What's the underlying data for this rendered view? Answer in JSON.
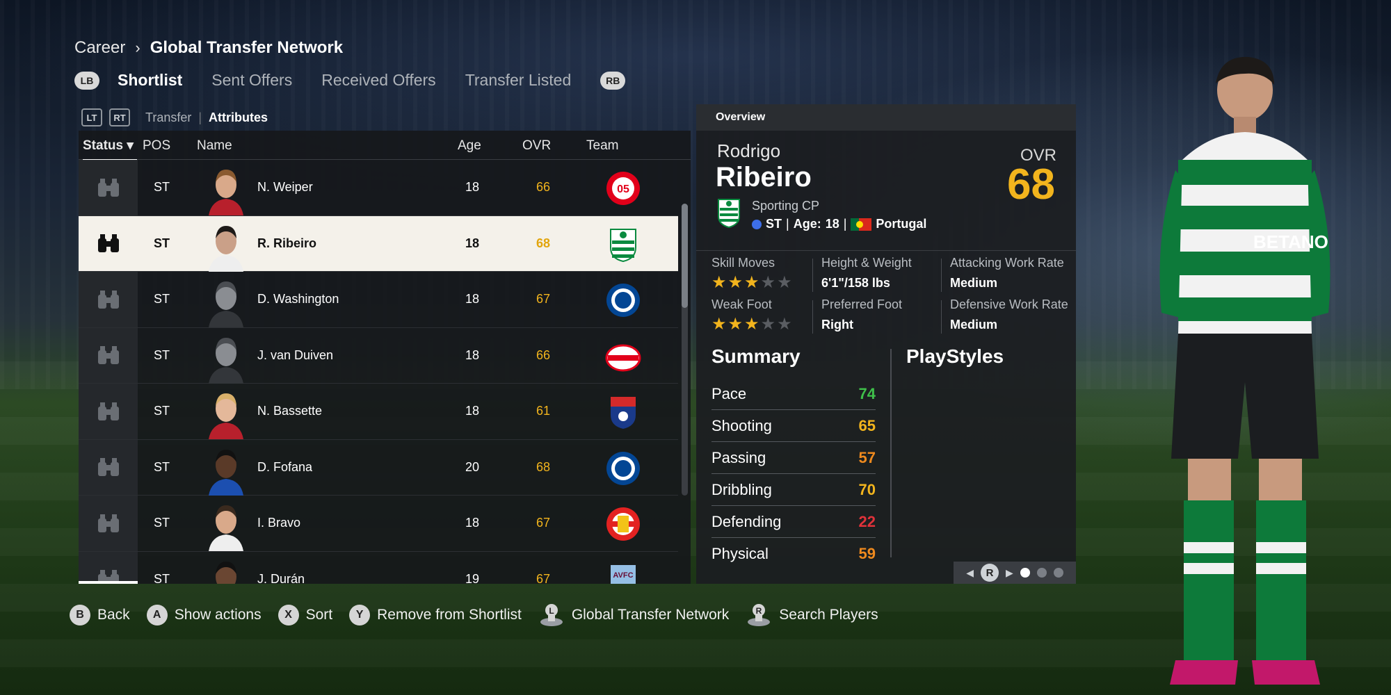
{
  "breadcrumb": {
    "root": "Career",
    "separator": "›",
    "current": "Global Transfer Network"
  },
  "tabs": {
    "left_button": "LB",
    "right_button": "RB",
    "items": [
      {
        "label": "Shortlist",
        "active": true
      },
      {
        "label": "Sent Offers",
        "active": false
      },
      {
        "label": "Received Offers",
        "active": false
      },
      {
        "label": "Transfer Listed",
        "active": false
      }
    ]
  },
  "subtabs": {
    "lt": "LT",
    "rt": "RT",
    "transfer": "Transfer",
    "separator": "|",
    "attributes": "Attributes"
  },
  "table": {
    "headers": {
      "status": "Status ▾",
      "pos": "POS",
      "name": "Name",
      "age": "Age",
      "ovr": "OVR",
      "team": "Team"
    },
    "rows": [
      {
        "pos": "ST",
        "name": "N. Weiper",
        "age": "18",
        "ovr": "66",
        "team": "mainz-crest"
      },
      {
        "pos": "ST",
        "name": "R. Ribeiro",
        "age": "18",
        "ovr": "68",
        "team": "sporting-crest",
        "selected": true
      },
      {
        "pos": "ST",
        "name": "D. Washington",
        "age": "18",
        "ovr": "67",
        "team": "chelsea-crest"
      },
      {
        "pos": "ST",
        "name": "J. van Duiven",
        "age": "18",
        "ovr": "66",
        "team": "psv-crest"
      },
      {
        "pos": "ST",
        "name": "N. Bassette",
        "age": "18",
        "ovr": "61",
        "team": "caen-crest"
      },
      {
        "pos": "ST",
        "name": "D. Fofana",
        "age": "20",
        "ovr": "68",
        "team": "chelsea-crest"
      },
      {
        "pos": "ST",
        "name": "I. Bravo",
        "age": "18",
        "ovr": "67",
        "team": "leverkusen-crest"
      },
      {
        "pos": "ST",
        "name": "J. Durán",
        "age": "19",
        "ovr": "67",
        "team": "aston-villa-crest"
      }
    ]
  },
  "overview": {
    "header": "Overview",
    "first_name": "Rodrigo",
    "last_name": "Ribeiro",
    "ovr_label": "OVR",
    "ovr": "68",
    "club": "Sporting CP",
    "position": "ST",
    "age_label": "Age:",
    "age": "18",
    "nation": "Portugal",
    "attributes": {
      "skill_moves_label": "Skill Moves",
      "skill_moves_stars": 3,
      "height_weight_label": "Height & Weight",
      "height_weight": "6'1\"/158 lbs",
      "attacking_wr_label": "Attacking Work Rate",
      "attacking_wr": "Medium",
      "weak_foot_label": "Weak Foot",
      "weak_foot_stars": 3,
      "preferred_foot_label": "Preferred Foot",
      "preferred_foot": "Right",
      "defensive_wr_label": "Defensive Work Rate",
      "defensive_wr": "Medium"
    },
    "summary_title": "Summary",
    "playstyles_title": "PlayStyles",
    "stats": [
      {
        "label": "Pace",
        "value": "74",
        "color": "#3fbf4a"
      },
      {
        "label": "Shooting",
        "value": "65",
        "color": "#f2b41d"
      },
      {
        "label": "Passing",
        "value": "57",
        "color": "#ef8a1e"
      },
      {
        "label": "Dribbling",
        "value": "70",
        "color": "#f2b41d"
      },
      {
        "label": "Defending",
        "value": "22",
        "color": "#e0323a"
      },
      {
        "label": "Physical",
        "value": "59",
        "color": "#ef8a1e"
      }
    ],
    "pager": {
      "button": "R",
      "pages": 3,
      "current": 1
    }
  },
  "footer": [
    {
      "button": "B",
      "label": "Back"
    },
    {
      "button": "A",
      "label": "Show actions"
    },
    {
      "button": "X",
      "label": "Sort"
    },
    {
      "button": "Y",
      "label": "Remove from Shortlist"
    },
    {
      "button": "L",
      "label": "Global Transfer Network"
    },
    {
      "button": "R",
      "label": "Search Players"
    }
  ],
  "colors": {
    "ovr_gold": "#f2b41d",
    "selected_row": "#f4f1ea",
    "sporting_green": "#0a8a3f"
  }
}
